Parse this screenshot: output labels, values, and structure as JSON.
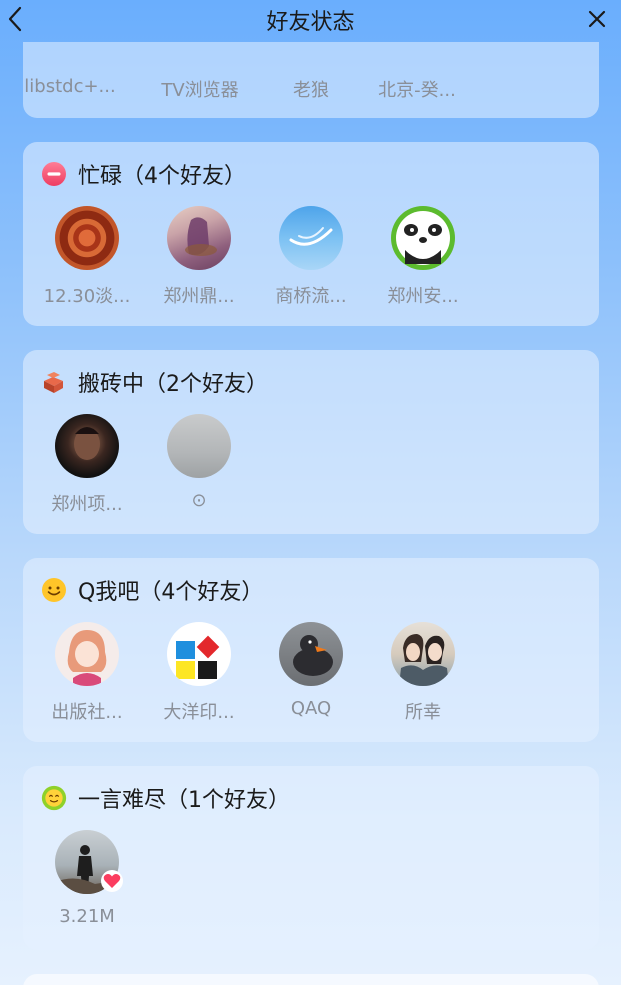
{
  "header": {
    "title": "好友状态"
  },
  "partial_group": {
    "names": [
      "libstdc+...",
      "TV浏览器",
      "老狼",
      "北京-癸..."
    ]
  },
  "groups": [
    {
      "id": "busy",
      "emoji": "minus-circle-icon",
      "title": "忙碌（4个好友）",
      "friends": [
        {
          "name": "12.30淡..."
        },
        {
          "name": "郑州鼎..."
        },
        {
          "name": "商桥流..."
        },
        {
          "name": "郑州安..."
        }
      ]
    },
    {
      "id": "working",
      "emoji": "brick-icon",
      "title": "搬砖中（2个好友）",
      "friends": [
        {
          "name": "郑州项..."
        },
        {
          "name": "⊙"
        }
      ]
    },
    {
      "id": "qme",
      "emoji": "smile-icon",
      "title": "Q我吧（4个好友）",
      "friends": [
        {
          "name": "出版社..."
        },
        {
          "name": "大洋印..."
        },
        {
          "name": "QAQ"
        },
        {
          "name": "所幸"
        }
      ]
    },
    {
      "id": "speechless",
      "emoji": "sun-face-icon",
      "title": "一言难尽（1个好友）",
      "friends": [
        {
          "name": "3.21M"
        }
      ]
    }
  ],
  "colors": {
    "accent_red": "#f2476a",
    "heart": "#fb3d5f"
  }
}
